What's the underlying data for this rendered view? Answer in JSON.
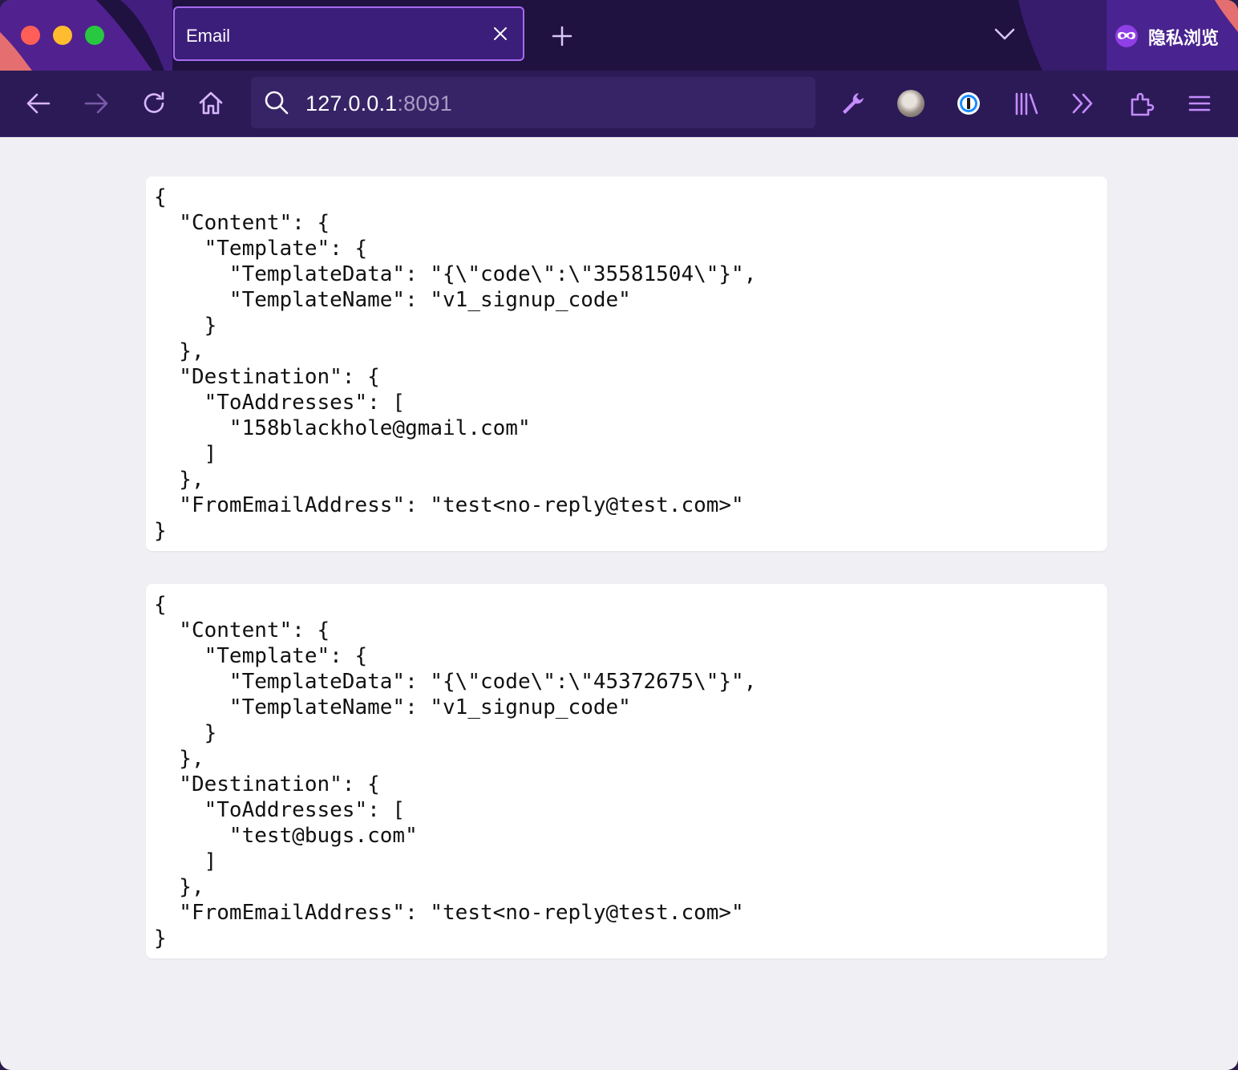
{
  "browser": {
    "tab": {
      "title": "Email"
    },
    "private_label": "隐私浏览",
    "url": {
      "host": "127.0.0.1",
      "port": ":8091"
    },
    "icons": {
      "back": "arrow-left-icon",
      "forward": "arrow-right-icon",
      "reload": "reload-icon",
      "home": "home-icon",
      "search": "search-icon",
      "wrench": "wrench-icon",
      "profile": "avatar",
      "password_manager": "1password-icon",
      "library": "library-icon",
      "overflow": "chevrons-icon",
      "extensions": "puzzle-icon",
      "menu": "hamburger-menu-icon"
    },
    "colors": {
      "frame": "#1f1140",
      "toolbar": "#2b1a56",
      "accent": "#a76bf0",
      "page_bg": "#f0f0f4"
    }
  },
  "messages": [
    {
      "json": "{\n  \"Content\": {\n    \"Template\": {\n      \"TemplateData\": \"{\\\"code\\\":\\\"35581504\\\"}\",\n      \"TemplateName\": \"v1_signup_code\"\n    }\n  },\n  \"Destination\": {\n    \"ToAddresses\": [\n      \"158blackhole@gmail.com\"\n    ]\n  },\n  \"FromEmailAddress\": \"test<no-reply@test.com>\"\n}"
    },
    {
      "json": "{\n  \"Content\": {\n    \"Template\": {\n      \"TemplateData\": \"{\\\"code\\\":\\\"45372675\\\"}\",\n      \"TemplateName\": \"v1_signup_code\"\n    }\n  },\n  \"Destination\": {\n    \"ToAddresses\": [\n      \"test@bugs.com\"\n    ]\n  },\n  \"FromEmailAddress\": \"test<no-reply@test.com>\"\n}"
    }
  ]
}
